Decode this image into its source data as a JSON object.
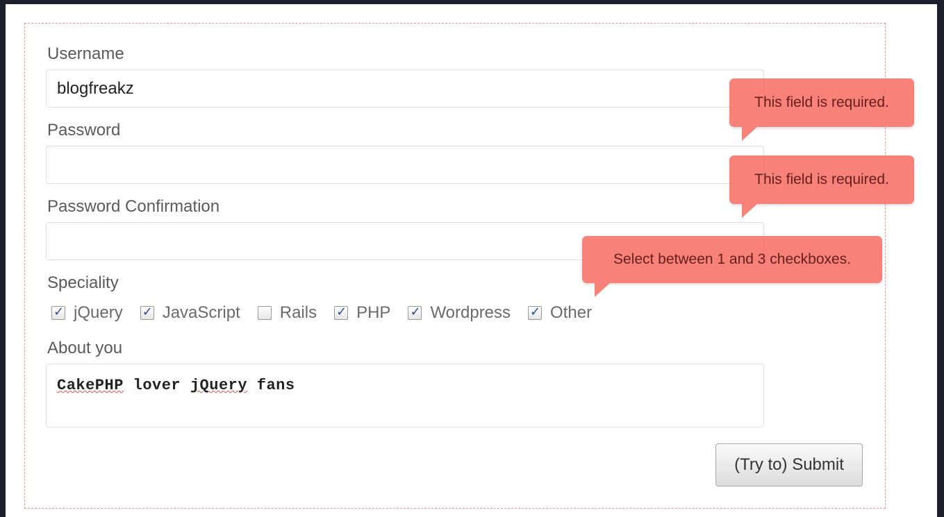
{
  "form": {
    "username": {
      "label": "Username",
      "value": "blogfreakz"
    },
    "password": {
      "label": "Password",
      "value": ""
    },
    "password_confirmation": {
      "label": "Password Confirmation",
      "value": ""
    },
    "speciality": {
      "label": "Speciality",
      "options": [
        {
          "label": "jQuery",
          "checked": true
        },
        {
          "label": "JavaScript",
          "checked": true
        },
        {
          "label": "Rails",
          "checked": false
        },
        {
          "label": "PHP",
          "checked": true
        },
        {
          "label": "Wordpress",
          "checked": true
        },
        {
          "label": "Other",
          "checked": true
        }
      ]
    },
    "about": {
      "label": "About you",
      "words": [
        "CakePHP",
        "lover",
        "jQuery",
        "fans"
      ]
    },
    "submit_label": "(Try to) Submit"
  },
  "tooltips": {
    "password_error": "This field is required.",
    "confirmation_error": "This field is required.",
    "speciality_error": "Select between 1 and 3 checkboxes."
  },
  "colors": {
    "tooltip_bg": "#f87b72",
    "form_border": "#f0948c",
    "background": "#1d1f2b"
  }
}
